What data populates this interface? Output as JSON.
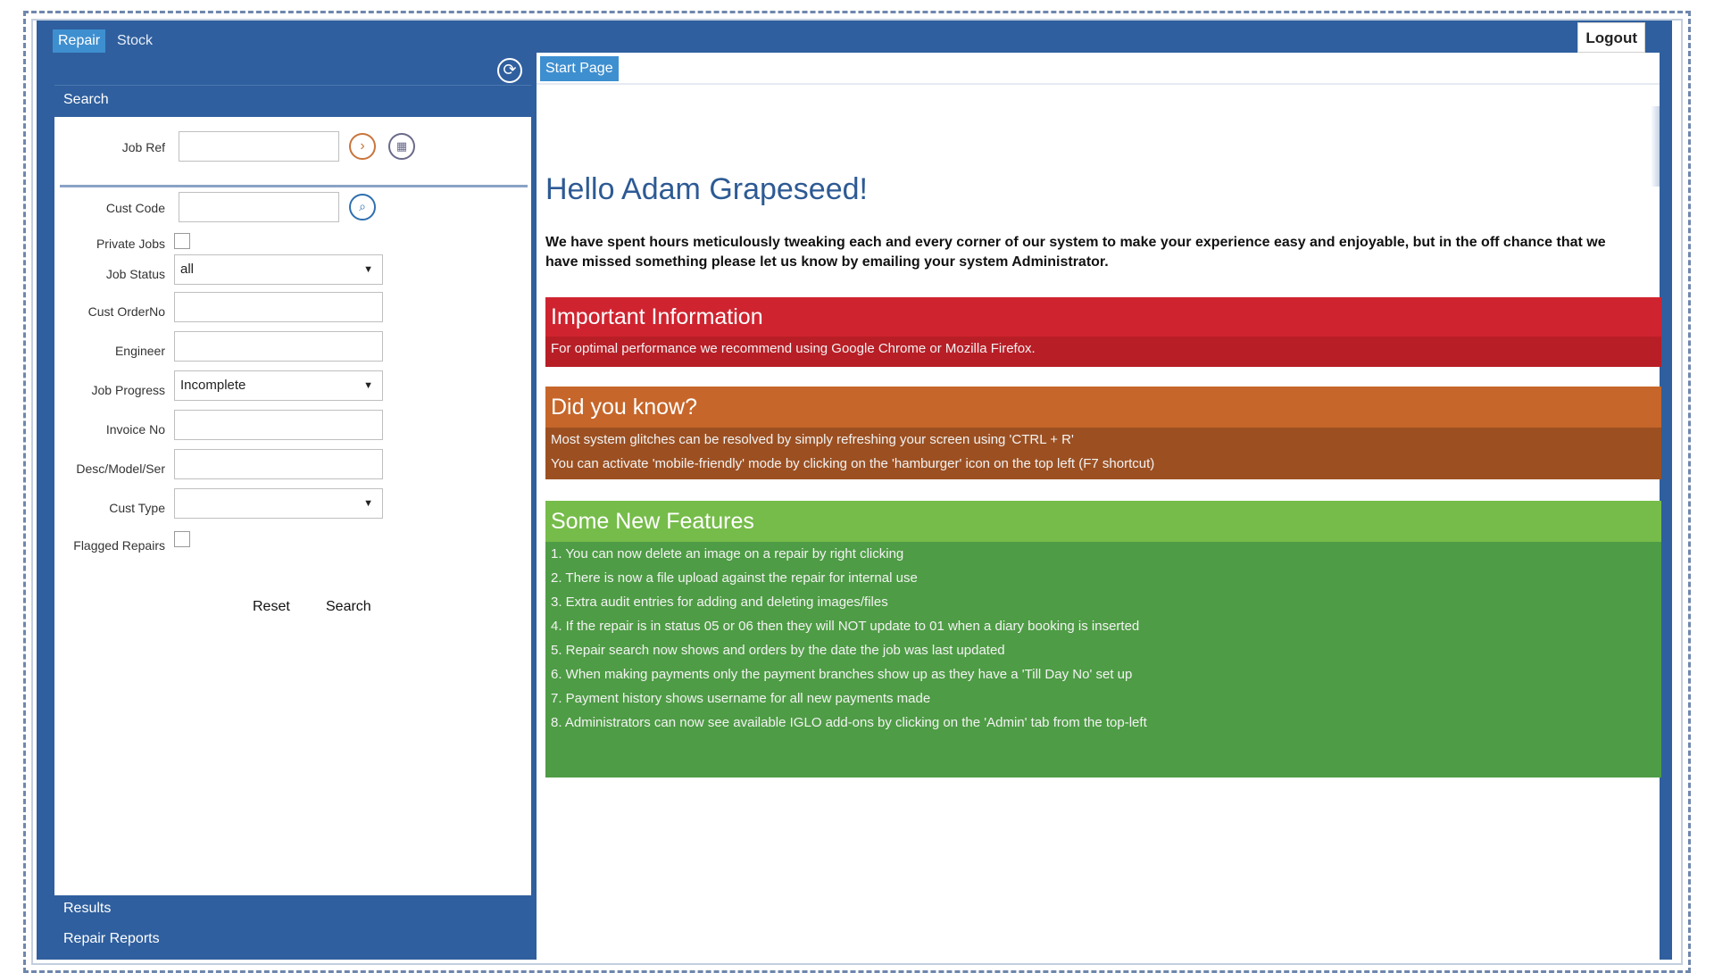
{
  "topbar": {
    "tabs": [
      {
        "label": "Repair",
        "active": true
      },
      {
        "label": "Stock",
        "active": false
      }
    ],
    "logout_label": "Logout"
  },
  "sidebar": {
    "header": "Search",
    "refresh_icon": "refresh-icon",
    "fields": {
      "job_ref": {
        "label": "Job Ref",
        "value": ""
      },
      "cust_code": {
        "label": "Cust Code",
        "value": ""
      },
      "private_jobs": {
        "label": "Private Jobs",
        "checked": false
      },
      "job_status": {
        "label": "Job Status",
        "value": "all"
      },
      "cust_order_no": {
        "label": "Cust OrderNo",
        "value": ""
      },
      "engineer": {
        "label": "Engineer",
        "value": ""
      },
      "job_progress": {
        "label": "Job Progress",
        "value": "Incomplete"
      },
      "invoice_no": {
        "label": "Invoice No",
        "value": ""
      },
      "desc_model_ser": {
        "label": "Desc/Model/Ser",
        "value": ""
      },
      "cust_type": {
        "label": "Cust Type",
        "value": ""
      },
      "flagged_repairs": {
        "label": "Flagged Repairs",
        "checked": false
      }
    },
    "reset_label": "Reset",
    "search_label": "Search",
    "footer_items": [
      "Results",
      "Repair Reports"
    ]
  },
  "main": {
    "tab_label": "Start Page",
    "greeting": "Hello Adam Grapeseed!",
    "intro": "We have spent hours meticulously tweaking each and every corner of our system to make your experience easy and enjoyable, but in the off chance that we have missed something please let us know by emailing your system Administrator.",
    "important": {
      "title": "Important Information",
      "lines": [
        "For optimal performance we recommend using Google Chrome or Mozilla Firefox."
      ]
    },
    "did_you_know": {
      "title": "Did you know?",
      "lines": [
        "Most system glitches can be resolved by simply refreshing your screen using 'CTRL + R'",
        "You can activate 'mobile-friendly' mode by clicking on the 'hamburger' icon on the top left (F7 shortcut)"
      ]
    },
    "features": {
      "title": "Some New Features",
      "lines": [
        "1. You can now delete an image on a repair by right clicking",
        "2. There is now a file upload against the repair for internal use",
        "3. Extra audit entries for adding and deleting images/files",
        "4. If the repair is in status 05 or 06 then they will NOT update to 01 when a diary booking is inserted",
        "5. Repair search now shows and orders by the date the job was last updated",
        "6. When making payments only the payment branches show up as they have a 'Till Day No' set up",
        "7. Payment history shows username for all new payments made",
        "8. Administrators can now see available IGLO add-ons by clicking on the 'Admin' tab from the top-left"
      ]
    }
  },
  "colors": {
    "brand_blue": "#2f5f9e",
    "tab_active": "#3e8fd0",
    "important_red": "#c42128",
    "know_orange": "#c6662a",
    "features_green": "#4e9c45"
  }
}
